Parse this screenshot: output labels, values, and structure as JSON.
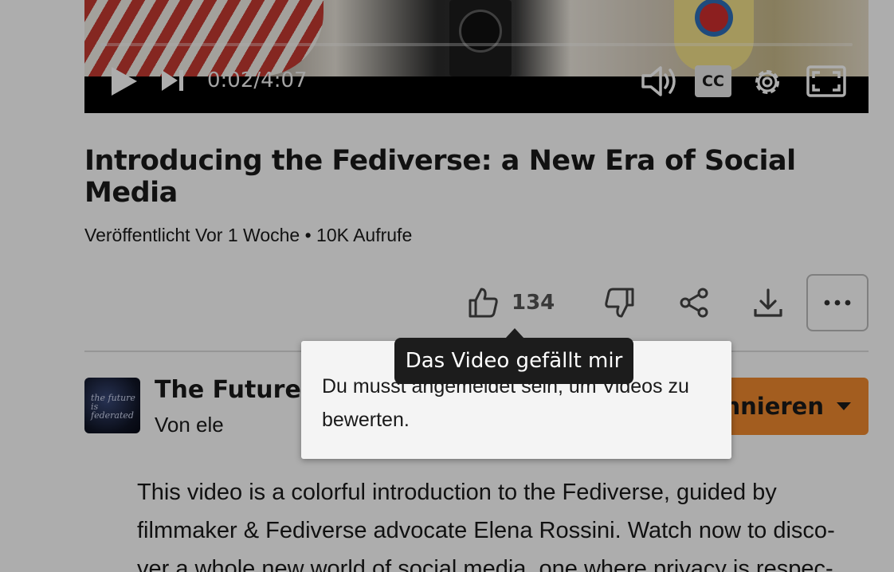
{
  "player": {
    "time_current": "0:02",
    "time_separator": "/",
    "time_total": "4:07",
    "progress": 0.008,
    "cc_label": "CC",
    "icons": [
      "play-icon",
      "skip-next-icon",
      "volume-icon",
      "captions-icon",
      "settings-icon",
      "fullscreen-icon"
    ]
  },
  "video": {
    "title": "Introducing the Fediverse: a New Era of Social Media",
    "meta": "Veröffentlicht Vor 1 Woche • 10K Aufrufe"
  },
  "actions": {
    "like_count": "134",
    "icons": [
      "thumbs-up-icon",
      "thumbs-down-icon",
      "share-icon",
      "download-icon",
      "more-icon"
    ]
  },
  "channel": {
    "name": "The Future Is",
    "by": "Von ele",
    "avatar_text": "the future is federated",
    "subscribe_label": "onnieren"
  },
  "description": {
    "text": "This video is a colorful introduction to the Fediverse, guided by filmmaker & Fediverse advocate Elena Rossini. Watch now to disco-ver a whole new world of social media, one where privacy is respec-"
  },
  "popup": {
    "text": "Du musst angemeldet sein, um Videos zu bewerten."
  },
  "tooltip": {
    "text": "Das Video gefällt mir"
  },
  "colors": {
    "subscribe": "#f08a2e",
    "tooltip_bg": "#1c1c1c",
    "overlay": "rgba(0,0,0,0.32)"
  }
}
